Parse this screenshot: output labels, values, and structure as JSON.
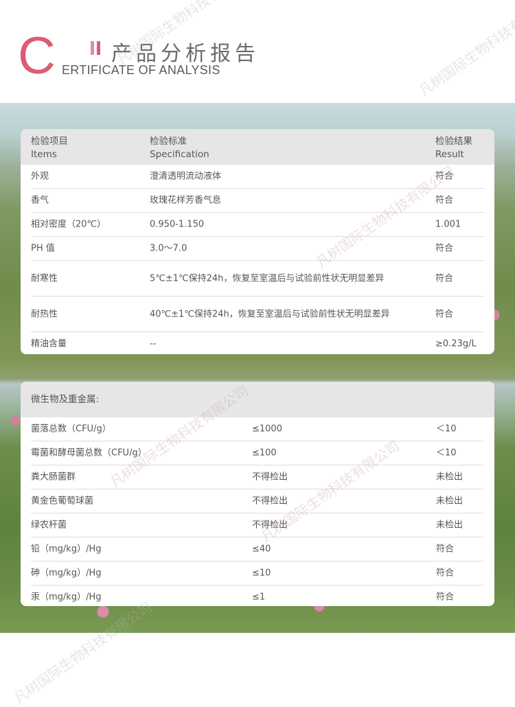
{
  "header": {
    "big_letter": "C",
    "title_cn": "产品分析报告",
    "title_en": "ERTIFICATE OF ANALYSIS",
    "brand_color": "#dc5c73"
  },
  "watermark": "凡树国际生物科技有限公司",
  "table1": {
    "headers": [
      {
        "cn": "检验项目",
        "en": "Items"
      },
      {
        "cn": "检验标准",
        "en": "Specification"
      },
      {
        "cn": "检验结果",
        "en": "Result"
      }
    ],
    "rows": [
      {
        "item": "外观",
        "spec": "澄清透明流动液体",
        "result": "符合"
      },
      {
        "item": "香气",
        "spec": "玫瑰花样芳香气息",
        "result": "符合"
      },
      {
        "item": "相对密度（20℃）",
        "spec": "0.950-1.150",
        "result": "1.001"
      },
      {
        "item": "PH 值",
        "spec": "3.0～7.0",
        "result": "符合"
      },
      {
        "item": "耐寒性",
        "spec": "5℃±1℃保持24h，恢复至室温后与试验前性状无明显差异",
        "result": "符合"
      },
      {
        "item": "耐热性",
        "spec": "40℃±1℃保持24h，恢复至室温后与试验前性状无明显差异",
        "result": "符合"
      },
      {
        "item": "精油含量",
        "spec": "--",
        "result": "≥0.23g/L"
      }
    ]
  },
  "table2": {
    "header": "微生物及重金属:",
    "rows": [
      {
        "item": "菌落总数（CFU/g）",
        "spec": "≤1000",
        "result": "＜10"
      },
      {
        "item": "霉菌和酵母菌总数（CFU/g）",
        "spec": "≤100",
        "result": "＜10"
      },
      {
        "item": "粪大肠菌群",
        "spec": "不得检出",
        "result": "未检出"
      },
      {
        "item": "黄金色葡萄球菌",
        "spec": "不得检出",
        "result": "未检出"
      },
      {
        "item": "绿农杆菌",
        "spec": "不得检出",
        "result": "未检出"
      },
      {
        "item": "铅（mg/kg）/Hg",
        "spec": "≤40",
        "result": "符合"
      },
      {
        "item": "砷（mg/kg）/Hg",
        "spec": "≤10",
        "result": "符合"
      },
      {
        "item": "汞（mg/kg）/Hg",
        "spec": "≤1",
        "result": "符合"
      }
    ]
  }
}
